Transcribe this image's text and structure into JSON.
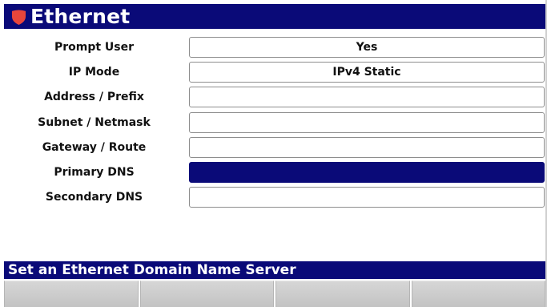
{
  "header": {
    "title": "Ethernet",
    "icon": "shield-icon",
    "accent_color": "#0a0a78",
    "icon_color": "#e8463b"
  },
  "settings": [
    {
      "label": "Prompt User",
      "value": "Yes",
      "selected": false
    },
    {
      "label": "IP Mode",
      "value": "IPv4 Static",
      "selected": false
    },
    {
      "label": "Address / Prefix",
      "value": "",
      "selected": false
    },
    {
      "label": "Subnet / Netmask",
      "value": "",
      "selected": false
    },
    {
      "label": "Gateway / Route",
      "value": "",
      "selected": false
    },
    {
      "label": "Primary DNS",
      "value": "",
      "selected": true
    },
    {
      "label": "Secondary DNS",
      "value": "",
      "selected": false
    }
  ],
  "status_bar": {
    "text": "Set an Ethernet Domain Name Server"
  },
  "softkeys": [
    {
      "label": ""
    },
    {
      "label": ""
    },
    {
      "label": ""
    },
    {
      "label": ""
    }
  ]
}
